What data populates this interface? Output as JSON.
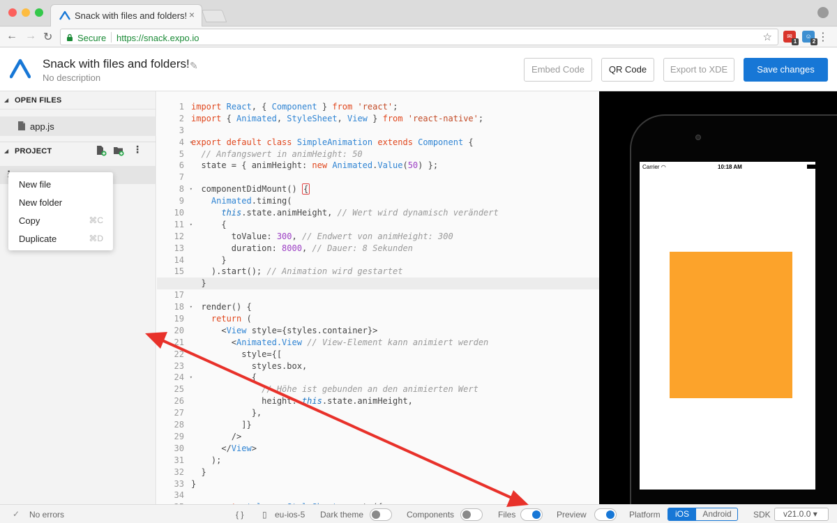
{
  "browser": {
    "tab_title": "Snack with files and folders!",
    "tab_close": "×",
    "secure_label": "Secure",
    "url": "https://snack.expo.io",
    "ext1_badge": "1",
    "ext2_badge": "2"
  },
  "header": {
    "title": "Snack with files and folders!",
    "description": "No description",
    "buttons": {
      "embed": "Embed Code",
      "qr": "QR Code",
      "export": "Export to XDE",
      "save": "Save changes"
    }
  },
  "sidebar": {
    "open_files_label": "OPEN FILES",
    "open_file": "app.js",
    "project_label": "PROJECT",
    "context_menu": [
      {
        "label": "New file",
        "shortcut": ""
      },
      {
        "label": "New folder",
        "shortcut": ""
      },
      {
        "label": "Copy",
        "shortcut": "⌘C"
      },
      {
        "label": "Duplicate",
        "shortcut": "⌘D"
      }
    ]
  },
  "editor": {
    "active_line": 16,
    "folded_lines": [
      4,
      8,
      11,
      18,
      22,
      24
    ],
    "lines": [
      "<span class=\"kw\">import</span> <span class=\"cls\">React</span>, { <span class=\"cls\">Component</span> } <span class=\"kw\">from</span> <span class=\"str\">'react'</span>;",
      "<span class=\"kw\">import</span> { <span class=\"cls\">Animated</span>, <span class=\"cls\">StyleSheet</span>, <span class=\"cls\">View</span> } <span class=\"kw\">from</span> <span class=\"str\">'react-native'</span>;",
      "",
      "<span class=\"kw\">export default class</span> <span class=\"cls\">SimpleAnimation</span> <span class=\"kw\">extends</span> <span class=\"cls\">Component</span> {",
      "  <span class=\"cm\">// Anfangswert in animHeight: 50</span>",
      "  state = { animHeight: <span class=\"kw\">new</span> <span class=\"cls\">Animated</span>.<span class=\"cls\">Value</span>(<span class=\"num\">50</span>) };",
      "",
      "  componentDidMount() <span class=\"br-mark\">{</span>",
      "    <span class=\"cls\">Animated</span>.timing(",
      "      <span class=\"this\">this</span>.state.animHeight, <span class=\"cm\">// Wert wird dynamisch verändert</span>",
      "      {",
      "        toValue: <span class=\"num\">300</span>, <span class=\"cm\">// Endwert von animHeight: 300</span>",
      "        duration: <span class=\"num\">8000</span>, <span class=\"cm\">// Dauer: 8 Sekunden</span>",
      "      }",
      "    ).start(); <span class=\"cm\">// Animation wird gestartet</span>",
      "  }",
      "",
      "  render() {",
      "    <span class=\"kw\">return</span> (",
      "      &lt;<span class=\"cls\">View</span> style={styles.container}&gt;",
      "        &lt;<span class=\"cls\">Animated.View</span> <span class=\"cm\">// View-Element kann animiert werden</span>",
      "          style={[",
      "            styles.box,",
      "            {",
      "              <span class=\"cm\">// Höhe ist gebunden an den animierten Wert</span>",
      "              height: <span class=\"this\">this</span>.state.animHeight,",
      "            },",
      "          ]}",
      "        /&gt;",
      "      &lt;/<span class=\"cls\">View</span>&gt;",
      "    );",
      "  }",
      "}",
      "",
      "    <span class=\"kw\">const</span> <span class=\"cls\">styles</span> = <span class=\"cls\">StyleSheet</span>.create({"
    ]
  },
  "preview": {
    "carrier": "Carrier",
    "time": "10:18 AM",
    "box_color": "#fca32b"
  },
  "footer": {
    "status": "No errors",
    "braces": "{ }",
    "device": "eu-ios-5",
    "dark_theme": {
      "label": "Dark theme",
      "on": false
    },
    "components": {
      "label": "Components",
      "on": false
    },
    "files": {
      "label": "Files",
      "on": true
    },
    "preview": {
      "label": "Preview",
      "on": true
    },
    "platform_label": "Platform",
    "platform_options": [
      "iOS",
      "Android"
    ],
    "platform_selected": "iOS",
    "sdk_label": "SDK",
    "sdk_value": "v21.0.0 ▾"
  },
  "colors": {
    "accent": "#1777d6",
    "annotation_arrow": "#e8312a"
  }
}
